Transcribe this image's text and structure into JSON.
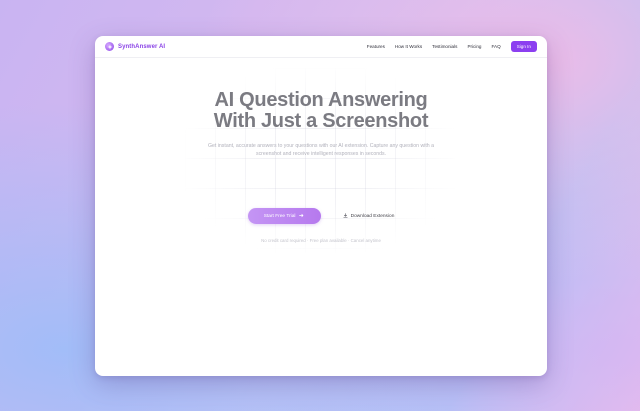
{
  "brand": {
    "name": "SynthAnswer AI",
    "logo_icon": "sparkle-icon",
    "accent": "#8c3ff0"
  },
  "nav": {
    "links": [
      "Features",
      "How It Works",
      "Testimonials",
      "Pricing",
      "FAQ"
    ],
    "signin_label": "Sign In"
  },
  "hero": {
    "headline_line1": "AI Question Answering",
    "headline_line2": "With Just a Screenshot",
    "subtext": "Get instant, accurate answers to your questions with our AI extension. Capture any question with a screenshot and receive intelligent responses in seconds.",
    "primary_label": "Start Free Trial",
    "secondary_label": "Download Extension",
    "trust_line": "No credit card required · Free plan available · Cancel anytime"
  }
}
